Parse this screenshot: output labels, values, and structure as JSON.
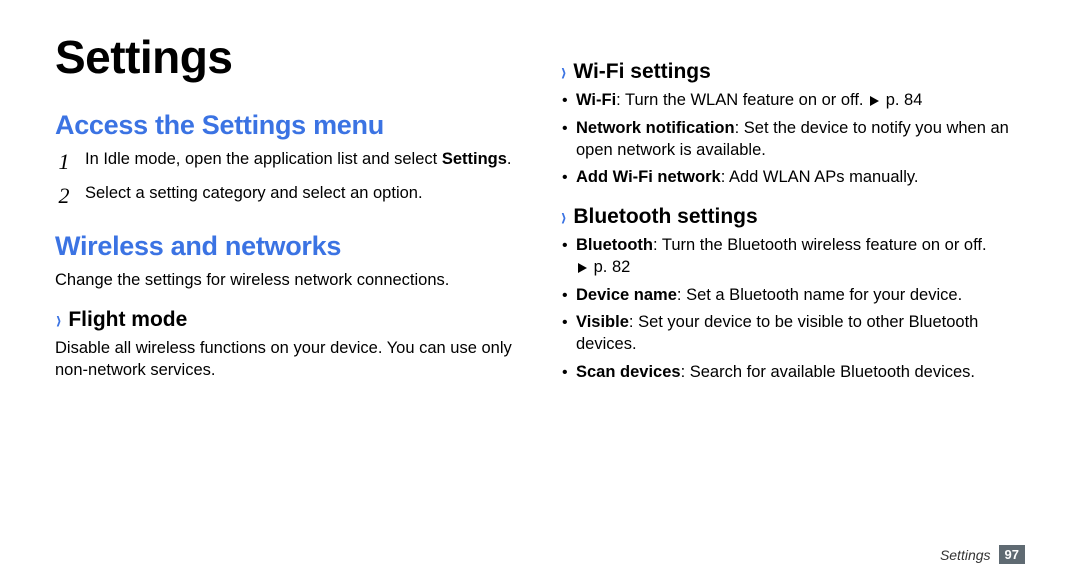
{
  "title": "Settings",
  "left": {
    "section1": {
      "heading": "Access the Settings menu",
      "steps": [
        {
          "num": "1",
          "pre": "In Idle mode, open the application list and select ",
          "bold": "Settings",
          "post": "."
        },
        {
          "num": "2",
          "pre": "Select a setting category and select an option.",
          "bold": "",
          "post": ""
        }
      ]
    },
    "section2": {
      "heading": "Wireless and networks",
      "intro": "Change the settings for wireless network connections.",
      "sub1": {
        "heading": "Flight mode",
        "text": "Disable all wireless functions on your device. You can use only non-network services."
      }
    }
  },
  "right": {
    "wifi": {
      "heading": "Wi-Fi settings",
      "items": [
        {
          "bold": "Wi-Fi",
          "text": ": Turn the WLAN feature on or off. ",
          "ref": "p. 84"
        },
        {
          "bold": "Network notification",
          "text": ": Set the device to notify you when an open network is available.",
          "ref": ""
        },
        {
          "bold": "Add Wi-Fi network",
          "text": ": Add WLAN APs manually.",
          "ref": ""
        }
      ]
    },
    "bt": {
      "heading": "Bluetooth settings",
      "items": [
        {
          "bold": "Bluetooth",
          "text": ": Turn the Bluetooth wireless feature on or off. ",
          "ref": "p. 82"
        },
        {
          "bold": "Device name",
          "text": ": Set a Bluetooth name for your device.",
          "ref": ""
        },
        {
          "bold": "Visible",
          "text": ": Set your device to be visible to other Bluetooth devices.",
          "ref": ""
        },
        {
          "bold": "Scan devices",
          "text": ": Search for available Bluetooth devices.",
          "ref": ""
        }
      ]
    }
  },
  "footer": {
    "section": "Settings",
    "page": "97"
  }
}
